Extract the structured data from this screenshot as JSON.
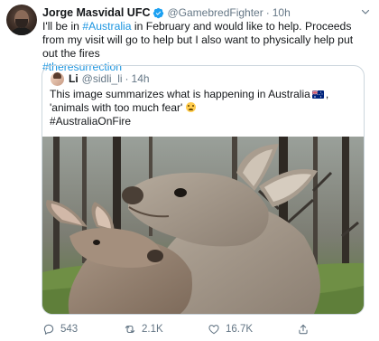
{
  "tweet": {
    "author_name": "Jorge Masvidal UFC",
    "author_handle": "@GamebredFighter",
    "separator": "·",
    "time": "10h",
    "text": {
      "part1": "I'll be in ",
      "tag1": "#Australia",
      "part2": " in February and would like to help. Proceeds from my visit will go to help but I also want to physically help put out the fires",
      "tag2": "#theresurrection"
    },
    "quoted": {
      "author_name": "Li",
      "author_handle": "@sidli_li",
      "separator": "·",
      "time": "14h",
      "text_part1": "This image summarizes what is happening in Australia",
      "text_part2": ", 'animals with too much fear'",
      "hashtag": "#AustraliaOnFire"
    },
    "actions": {
      "replies": "543",
      "retweets": "2.1K",
      "likes": "16.7K"
    }
  },
  "icons": {
    "verified": "verified-badge-icon",
    "caret": "chevron-down-icon",
    "reply": "reply-icon",
    "retweet": "retweet-icon",
    "like": "heart-icon",
    "share": "share-icon",
    "flag": "australia-flag-emoji",
    "emoji": "fearful-face-emoji"
  },
  "colors": {
    "link": "#1b95e0",
    "secondary_text": "#657786",
    "border": "#ccd6dd",
    "verified": "#1da1f2"
  }
}
